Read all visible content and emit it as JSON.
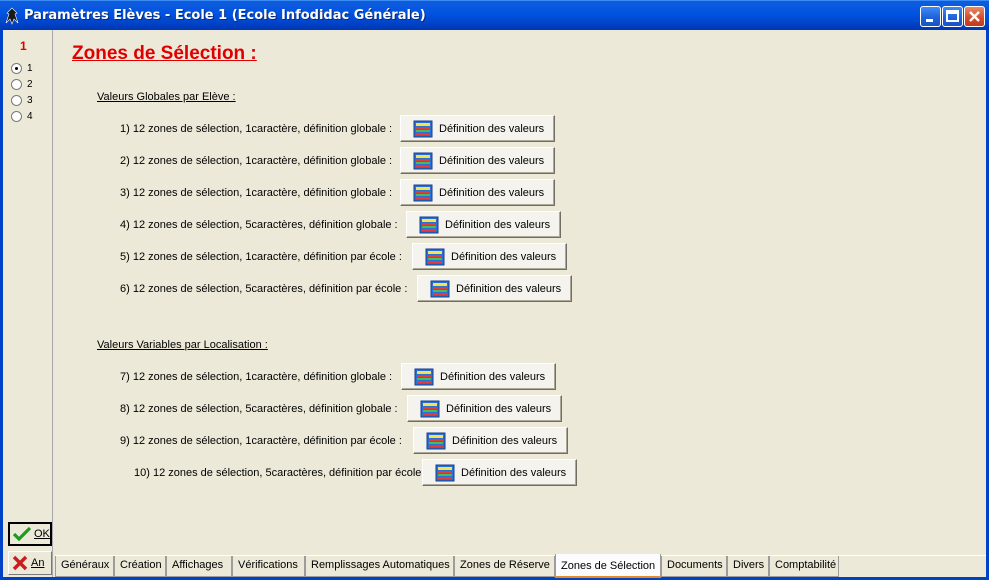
{
  "window": {
    "title": "Paramètres Elèves - Ecole 1 (Ecole Infodidac Générale)"
  },
  "sidebar": {
    "page_number": "1",
    "radios": [
      {
        "label": "1",
        "checked": true
      },
      {
        "label": "2",
        "checked": false
      },
      {
        "label": "3",
        "checked": false
      },
      {
        "label": "4",
        "checked": false
      }
    ],
    "ok_label": "OK",
    "cancel_label": "An"
  },
  "main": {
    "heading": "Zones de Sélection :",
    "section_global": "Valeurs Globales par Elève :",
    "section_variable": "Valeurs Variables par Localisation :",
    "button_label": "Définition des valeurs",
    "rows": [
      "1) 12 zones de sélection, 1caractère, définition globale :",
      "2) 12 zones de sélection, 1caractère, définition globale :",
      "3) 12 zones de sélection, 1caractère, définition globale :",
      "4) 12 zones de sélection, 5caractères, définition globale :",
      "5) 12 zones de sélection, 1caractère, définition par école :",
      "6) 12 zones de sélection, 5caractères, définition par école :",
      "7) 12 zones de sélection, 1caractère, définition globale :",
      "8) 12 zones de sélection, 5caractères, définition globale :",
      "9) 12 zones de sélection, 1caractère, définition par école :",
      "10) 12 zones de sélection, 5caractères, définition par école :"
    ]
  },
  "tabs": [
    {
      "label": "Généraux",
      "active": false
    },
    {
      "label": "Création",
      "active": false
    },
    {
      "label": "Affichages",
      "active": false
    },
    {
      "label": "Vérifications",
      "active": false
    },
    {
      "label": "Remplissages Automatiques",
      "active": false
    },
    {
      "label": "Zones de Réserve",
      "active": false
    },
    {
      "label": "Zones de Sélection",
      "active": true
    },
    {
      "label": "Documents",
      "active": false
    },
    {
      "label": "Divers",
      "active": false
    },
    {
      "label": "Comptabilité",
      "active": false
    }
  ],
  "icons": {
    "app": "app-icon",
    "minimize": "minimize-icon",
    "maximize": "maximize-icon",
    "close": "close-icon",
    "ok": "checkmark-icon",
    "cancel": "cross-icon",
    "definition": "table-edit-icon"
  },
  "colors": {
    "heading": "#E00000",
    "titlebar": "#0054E3",
    "active_tab_accent": "#E68B2C"
  }
}
